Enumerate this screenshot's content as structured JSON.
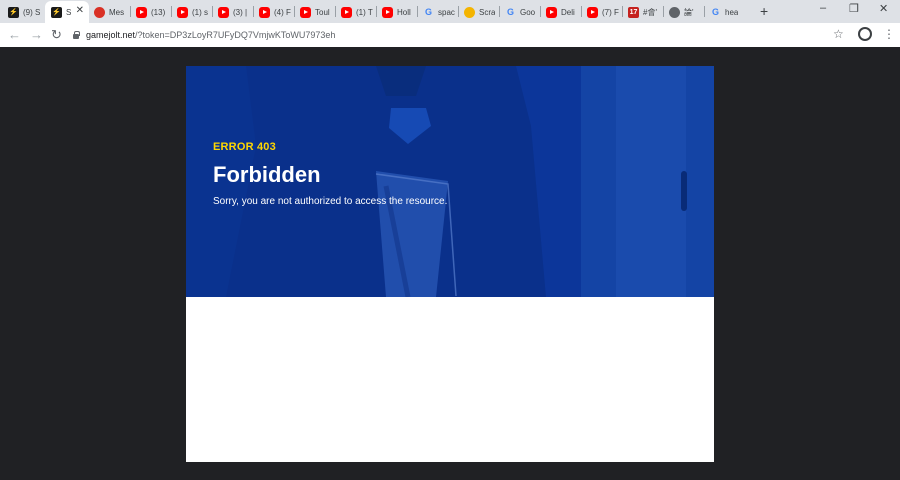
{
  "browser": {
    "tabs": [
      {
        "label": "(9) S",
        "icon": "gamejolt-icon"
      },
      {
        "label": "S",
        "icon": "gamejolt-icon",
        "active": true
      },
      {
        "label": "Mes",
        "icon": "messenger-icon"
      },
      {
        "label": "(13)",
        "icon": "youtube-icon"
      },
      {
        "label": "(1) s",
        "icon": "youtube-icon"
      },
      {
        "label": "(3) |",
        "icon": "youtube-icon"
      },
      {
        "label": "(4) F",
        "icon": "youtube-icon"
      },
      {
        "label": "Toul",
        "icon": "youtube-icon"
      },
      {
        "label": "(1) T",
        "icon": "youtube-icon"
      },
      {
        "label": "Holl",
        "icon": "youtube-icon"
      },
      {
        "label": "spac",
        "icon": "google-icon"
      },
      {
        "label": "Scra",
        "icon": "coin-icon"
      },
      {
        "label": "Goo",
        "icon": "google-icon"
      },
      {
        "label": "Deli",
        "icon": "youtube-icon"
      },
      {
        "label": "(7) F",
        "icon": "youtube-icon"
      },
      {
        "label": "#會'",
        "icon": "kr-icon"
      },
      {
        "label": "論'",
        "icon": "globe-icon"
      },
      {
        "label": "hea",
        "icon": "google-icon"
      }
    ],
    "url_domain": "gamejolt.net",
    "url_path": "/?token=DP3zLoyR7UFyDQ7VmjwKToWU7973eh"
  },
  "error": {
    "code": "ERROR 403",
    "title": "Forbidden",
    "message": "Sorry, you are not authorized to access the resource."
  },
  "colors": {
    "hero_blue": "#0d3aa3",
    "accent_yellow": "#ffd700",
    "page_bg": "#202124"
  }
}
